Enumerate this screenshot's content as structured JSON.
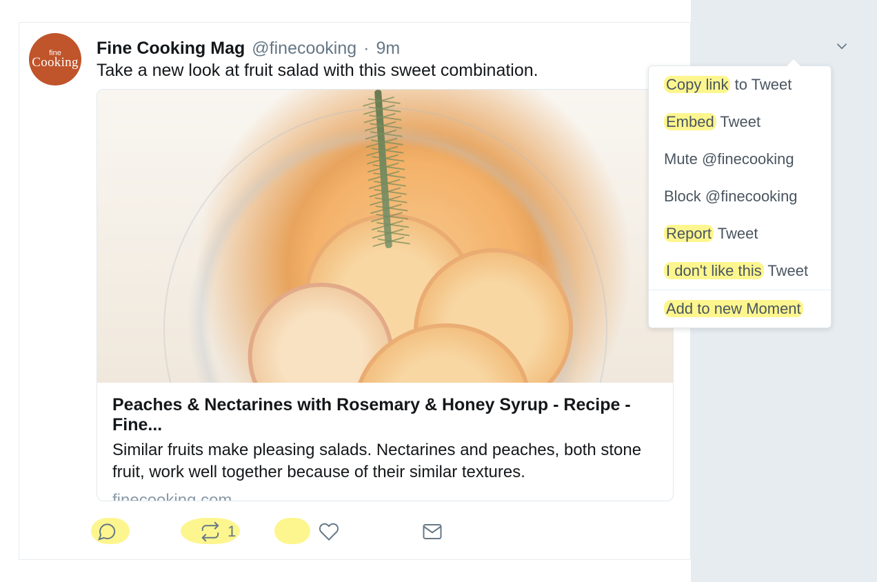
{
  "tweet": {
    "avatar_line1": "fine",
    "avatar_line2": "Cooking",
    "display_name": "Fine Cooking Mag",
    "handle": "@finecooking",
    "separator": " · ",
    "timestamp": "9m",
    "text": "Take a new look at fruit salad with this sweet combination."
  },
  "card": {
    "title": "Peaches & Nectarines with Rosemary & Honey Syrup - Recipe - Fine...",
    "description": "Similar fruits make pleasing salads. Nectarines and peaches, both stone fruit, work well together because of their similar textures.",
    "domain": "finecooking.com"
  },
  "actions": {
    "retweet_count": "1"
  },
  "menu": {
    "copy_link": "Copy link to Tweet",
    "embed": "Embed Tweet",
    "mute": "Mute @finecooking",
    "block": "Block @finecooking",
    "report": "Report Tweet",
    "dont_like": "I don't like this Tweet",
    "add_moment": "Add to new Moment"
  },
  "highlights": {
    "copy_link": "Copy link",
    "embed": "Embed",
    "report": "Report",
    "dont_like": "I don't like this",
    "add_moment": "Add to new Moment"
  },
  "colors": {
    "avatar_bg": "#c0542b",
    "highlight": "#fdf68f",
    "text_muted": "#657786"
  }
}
